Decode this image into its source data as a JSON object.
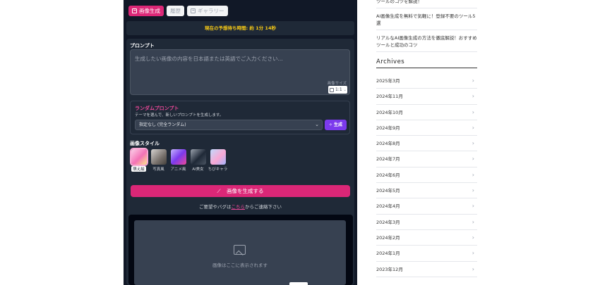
{
  "app": {
    "tabs": [
      {
        "label": "画像生成",
        "active": true
      },
      {
        "label": "履歴",
        "active": false
      },
      {
        "label": "ギャラリー",
        "active": false
      }
    ],
    "timer_text": "現在の予想待ち時間: 約 1分 14秒",
    "prompt": {
      "label": "プロンプト",
      "placeholder": "生成したい画像の内容を日本語または英語でご入力ください...",
      "size_label": "画像サイズ",
      "size_value": "1:1"
    },
    "random": {
      "title": "ランダムプロンプト",
      "description": "テーマを選んで、新しいプロンプトを生成します。",
      "select_value": "指定なし (完全ランダム)",
      "button_label": "生成"
    },
    "style": {
      "label": "画像スタイル",
      "options": [
        {
          "label": "萌え絵",
          "selected": true,
          "color": "#f9a8d4"
        },
        {
          "label": "写真風",
          "selected": false,
          "color": "#a8a29e"
        },
        {
          "label": "アニメ風",
          "selected": false,
          "color": "#9f7aea"
        },
        {
          "label": "AI美女",
          "selected": false,
          "color": "#6b7280"
        },
        {
          "label": "ちびキャラ",
          "selected": false,
          "color": "#93c5fd"
        }
      ]
    },
    "generate_label": "画像を生成する",
    "contact": {
      "prefix": "ご要望やバグは",
      "link": "こちら",
      "suffix": "からご連絡下さい"
    },
    "preview_text": "画像はここに表示されます",
    "colors": {
      "accent": "#db2777",
      "timer": "#facc15",
      "purple": "#7c3aed",
      "panel": "#111827"
    }
  },
  "sidebar": {
    "articles": [
      "ツールのコツを解説！",
      "AI画像生成を無料で気軽に！登録不要のツール5選",
      "リアルなAI画像生成の方法を徹底解説！おすすめツールと成功のコツ"
    ],
    "archives_title": "Archives",
    "archives": [
      "2025年3月",
      "2024年11月",
      "2024年10月",
      "2024年9月",
      "2024年8月",
      "2024年7月",
      "2024年6月",
      "2024年5月",
      "2024年4月",
      "2024年3月",
      "2024年2月",
      "2024年1月",
      "2023年12月"
    ]
  }
}
